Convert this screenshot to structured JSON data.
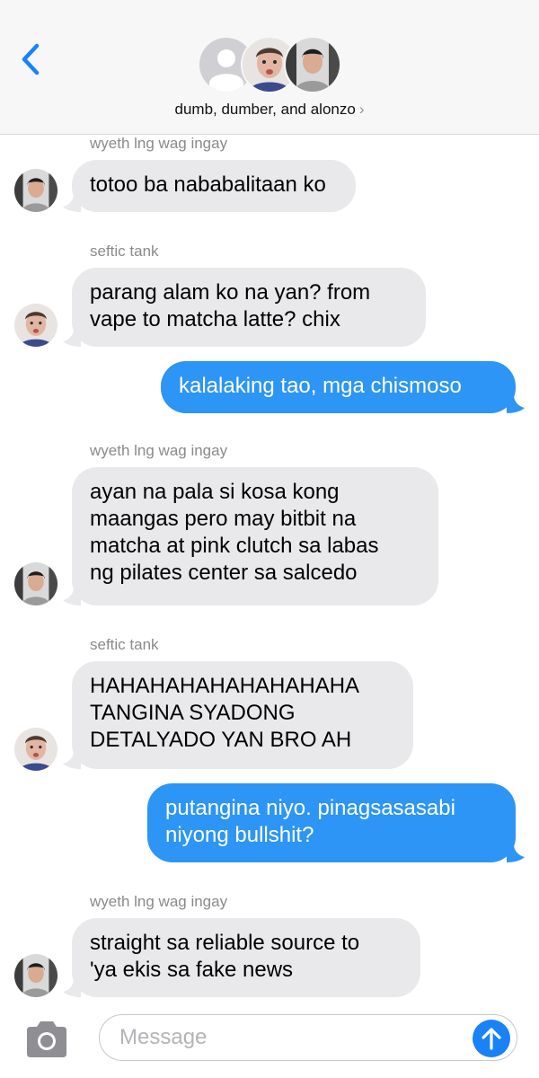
{
  "header": {
    "back_icon": "chevron-left-icon",
    "group_name": "dumb, dumber, and alonzo",
    "chevron": "›",
    "avatars": [
      "person-placeholder-avatar",
      "seftic-tank-avatar",
      "wyeth-avatar"
    ]
  },
  "colors": {
    "accent": "#2c95f5",
    "incoming_bubble": "#e9e9eb",
    "sender_label": "#8a8a8e",
    "send_button": "#1a82f7"
  },
  "messages": [
    {
      "sender": "wyeth lng wag ingay",
      "text": "totoo ba nababalitaan ko"
    },
    {
      "sender": "seftic tank",
      "text": "parang alam ko na yan? from\nvape to matcha latte? chix"
    },
    {
      "text": "kalalaking tao, mga chismoso"
    },
    {
      "sender": "wyeth lng wag ingay",
      "text": "ayan na pala si kosa kong\nmaangas pero may bitbit na\nmatcha at pink clutch sa labas\nng pilates center sa salcedo"
    },
    {
      "sender": "seftic tank",
      "text": "HAHAHAHAHAHAHAHAHA\nTANGINA SYADONG\nDETALYADO YAN BRO AH"
    },
    {
      "text": "putangina niyo. pinagsasasabi\nniyong bullshit?"
    },
    {
      "sender": "wyeth lng wag ingay",
      "text": "straight sa reliable source to\n'ya ekis sa fake news"
    }
  ],
  "input": {
    "placeholder": "Message",
    "camera_icon": "camera-icon",
    "send_icon": "arrow-up-icon"
  }
}
